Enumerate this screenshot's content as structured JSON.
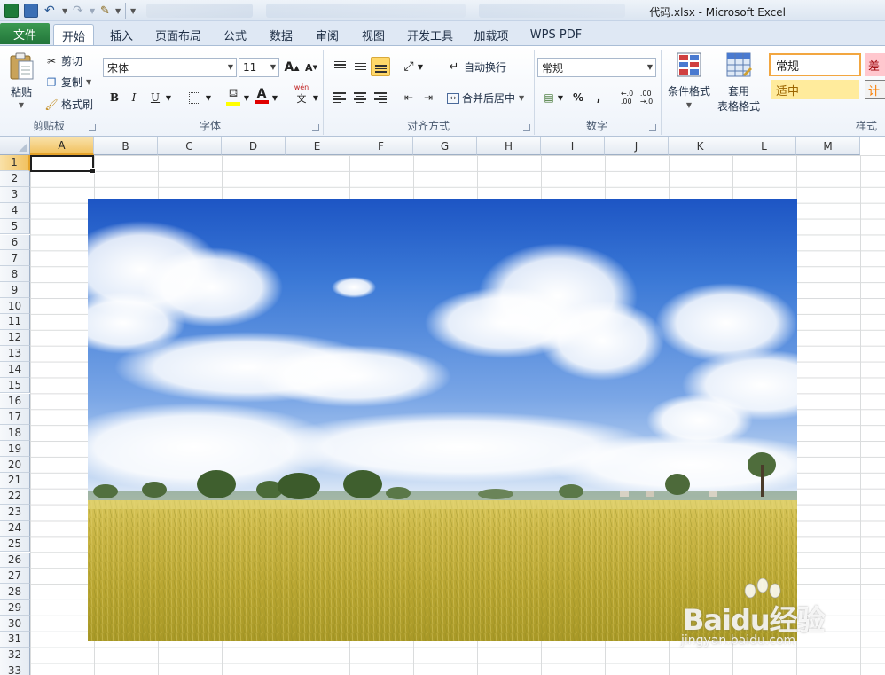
{
  "titlebar": {
    "window_title": "代码.xlsx - Microsoft Excel"
  },
  "tabs": {
    "file": "文件",
    "items": [
      "开始",
      "插入",
      "页面布局",
      "公式",
      "数据",
      "审阅",
      "视图",
      "开发工具",
      "加载项",
      "WPS PDF"
    ],
    "active_index": 0
  },
  "clipboard": {
    "paste": "粘贴",
    "cut": "剪切",
    "copy": "复制",
    "format_painter": "格式刷",
    "label": "剪贴板"
  },
  "font": {
    "name": "宋体",
    "size": "11",
    "bold": "B",
    "italic": "I",
    "underline": "U",
    "grow": "A",
    "shrink": "A",
    "font_color": "A",
    "phonetic": "wén",
    "label": "字体"
  },
  "alignment": {
    "wrap_text": "自动换行",
    "merge_center": "合并后居中",
    "label": "对齐方式"
  },
  "number": {
    "format": "常规",
    "percent": "%",
    "comma": ",",
    "label": "数字"
  },
  "styles": {
    "conditional": "条件格式",
    "table_line1": "套用",
    "table_line2": "表格格式",
    "normal": "常规",
    "bad": "差",
    "neutral": "适中",
    "calc": "计",
    "label": "样式"
  },
  "sheet": {
    "columns": [
      "A",
      "B",
      "C",
      "D",
      "E",
      "F",
      "G",
      "H",
      "I",
      "J",
      "K",
      "L",
      "M"
    ],
    "rows": [
      "1",
      "2",
      "3",
      "4",
      "5",
      "6",
      "7",
      "8",
      "9",
      "10",
      "11",
      "12",
      "13",
      "14",
      "15",
      "16",
      "17",
      "18",
      "19",
      "20",
      "21",
      "22",
      "23",
      "24",
      "25",
      "26",
      "27",
      "28",
      "29",
      "30",
      "31",
      "32",
      "33"
    ],
    "active_cell": "A1"
  },
  "colors": {
    "file_tab": "#2a8342",
    "selected_header": "#f1c15f",
    "style_bad_fill": "#ffc7ce",
    "style_neutral_fill": "#ffeb9c"
  },
  "watermark": {
    "text": "Baidu经验",
    "sub": "jingyan.baidu.com"
  }
}
